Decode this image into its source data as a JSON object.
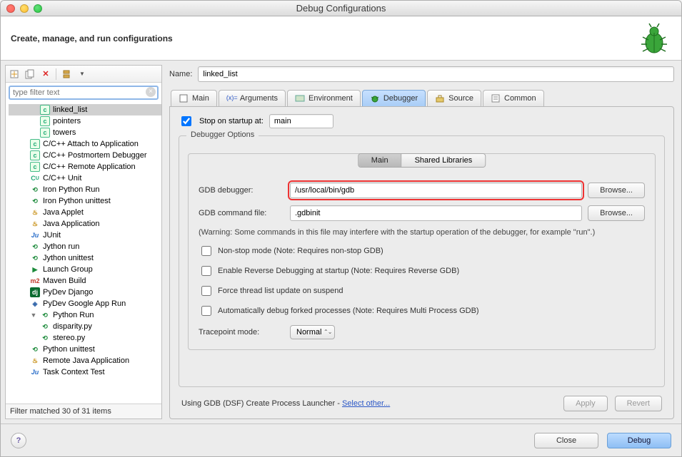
{
  "window": {
    "title": "Debug Configurations"
  },
  "banner": {
    "message": "Create, manage, and run configurations"
  },
  "toolbar_icons": [
    "new-config",
    "duplicate",
    "delete",
    "collapse-all",
    "filter-menu"
  ],
  "filter": {
    "placeholder": "type filter text"
  },
  "tree": {
    "items": [
      {
        "label": "linked_list",
        "icon": "c",
        "indent": 2,
        "selected": true
      },
      {
        "label": "pointers",
        "icon": "c",
        "indent": 2
      },
      {
        "label": "towers",
        "icon": "c",
        "indent": 2
      },
      {
        "label": "C/C++ Attach to Application",
        "icon": "c",
        "indent": 1
      },
      {
        "label": "C/C++ Postmortem Debugger",
        "icon": "c",
        "indent": 1
      },
      {
        "label": "C/C++ Remote Application",
        "icon": "c",
        "indent": 1
      },
      {
        "label": "C/C++ Unit",
        "icon": "cu",
        "indent": 1
      },
      {
        "label": "Iron Python Run",
        "icon": "py",
        "indent": 1
      },
      {
        "label": "Iron Python unittest",
        "icon": "py",
        "indent": 1
      },
      {
        "label": "Java Applet",
        "icon": "j",
        "indent": 1
      },
      {
        "label": "Java Application",
        "icon": "j",
        "indent": 1
      },
      {
        "label": "JUnit",
        "icon": "ju",
        "indent": 1
      },
      {
        "label": "Jython run",
        "icon": "py",
        "indent": 1
      },
      {
        "label": "Jython unittest",
        "icon": "py",
        "indent": 1
      },
      {
        "label": "Launch Group",
        "icon": "grp",
        "indent": 1
      },
      {
        "label": "Maven Build",
        "icon": "m2",
        "indent": 1
      },
      {
        "label": "PyDev Django",
        "icon": "dj",
        "indent": 1
      },
      {
        "label": "PyDev Google App Run",
        "icon": "go",
        "indent": 1
      },
      {
        "label": "Python Run",
        "icon": "py",
        "indent": 1,
        "expanded": true
      },
      {
        "label": "disparity.py",
        "icon": "py",
        "indent": 2
      },
      {
        "label": "stereo.py",
        "icon": "py",
        "indent": 2
      },
      {
        "label": "Python unittest",
        "icon": "py",
        "indent": 1
      },
      {
        "label": "Remote Java Application",
        "icon": "j",
        "indent": 1
      },
      {
        "label": "Task Context Test",
        "icon": "ju",
        "indent": 1
      }
    ],
    "status": "Filter matched 30 of 31 items"
  },
  "form": {
    "name_label": "Name:",
    "name_value": "linked_list",
    "tabs": [
      {
        "label": "Main"
      },
      {
        "label": "Arguments"
      },
      {
        "label": "Environment"
      },
      {
        "label": "Debugger"
      },
      {
        "label": "Source"
      },
      {
        "label": "Common"
      }
    ],
    "active_tab": "Debugger",
    "stop_on_startup": {
      "label": "Stop on startup at:",
      "checked": true,
      "value": "main"
    },
    "options_legend": "Debugger Options",
    "inner_tabs": {
      "active": "Main",
      "other": "Shared Libraries"
    },
    "gdb_debugger": {
      "label": "GDB debugger:",
      "value": "/usr/local/bin/gdb",
      "browse": "Browse..."
    },
    "gdb_cmd": {
      "label": "GDB command file:",
      "value": ".gdbinit",
      "browse": "Browse..."
    },
    "warning": "(Warning: Some commands in this file may interfere with the startup operation of the debugger, for example \"run\".)",
    "checks": [
      {
        "label": "Non-stop mode (Note: Requires non-stop GDB)",
        "checked": false
      },
      {
        "label": "Enable Reverse Debugging at startup (Note: Requires Reverse GDB)",
        "checked": false
      },
      {
        "label": "Force thread list update on suspend",
        "checked": false
      },
      {
        "label": "Automatically debug forked processes (Note: Requires Multi Process GDB)",
        "checked": false
      }
    ],
    "tracepoint": {
      "label": "Tracepoint mode:",
      "value": "Normal"
    },
    "launcher_text": "Using GDB (DSF) Create Process Launcher - ",
    "launcher_link": "Select other...",
    "apply": "Apply",
    "revert": "Revert"
  },
  "footer": {
    "close": "Close",
    "debug": "Debug",
    "help": "?"
  }
}
